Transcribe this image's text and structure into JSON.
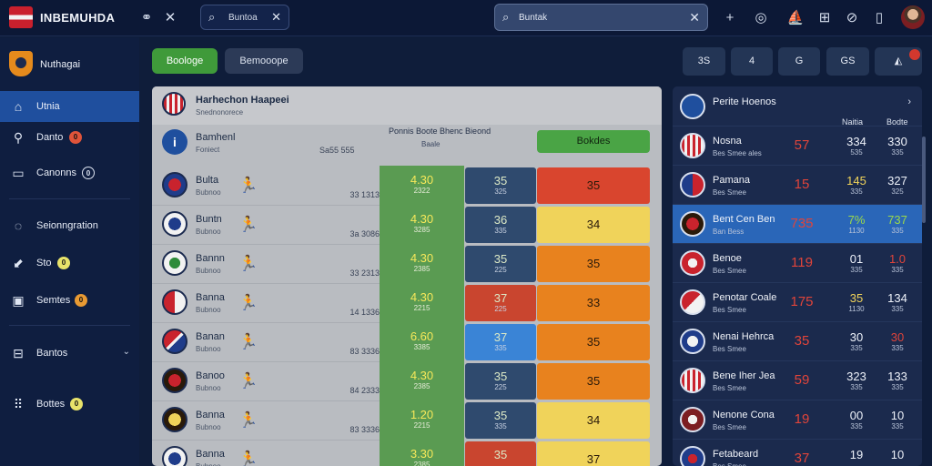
{
  "app": {
    "brand": "INBEMUHDA"
  },
  "top_search": {
    "value": "Buntoa",
    "placeholder": "Buntoa"
  },
  "main_search": {
    "value": "Buntak",
    "placeholder": "Buntak"
  },
  "sidebar": {
    "header": "Nuthagai",
    "items": [
      {
        "label": "Utnia",
        "icon": "home-icon",
        "active": true
      },
      {
        "label": "Danto",
        "icon": "person-icon",
        "dot": "0",
        "dot_color": "#e0543a"
      },
      {
        "label": "Canonns",
        "icon": "briefcase-icon",
        "dot": "0",
        "dot_color": "#dfe6f3"
      },
      {
        "label": "Seionngration",
        "icon": "settings-icon"
      },
      {
        "label": "Sto",
        "icon": "tag-icon",
        "dot": "0",
        "dot_color": "#e8e36a"
      },
      {
        "label": "Semtes",
        "icon": "bag-icon",
        "dot": "0",
        "dot_color": "#e89a33"
      },
      {
        "label": "Bantos",
        "icon": "chart-icon"
      },
      {
        "label": "Bottes",
        "icon": "grid-icon",
        "dot": "0",
        "dot_color": "#e8e36a"
      }
    ]
  },
  "actions": {
    "green_label": "Boologe",
    "dark_label": "Bemooope",
    "icon_buttons": [
      "3S",
      "4",
      "G",
      "GS"
    ]
  },
  "center": {
    "title": "Harhechon Haapeei",
    "subtitle": "Snednonorece",
    "col_header": "Ponnis Boote Bhenc Bieond",
    "col_sub": "Baale",
    "green_header": "Bokdes",
    "info": {
      "name": "Bamhenl",
      "sub": "Foniect",
      "value": "Sa55 555"
    },
    "rows": [
      {
        "name": "Bulta",
        "sub": "Bubnoo",
        "value": "33 1313",
        "odd1": "4.30",
        "odd1_sub": "2322",
        "odd2": "35",
        "odd2_sub": "325",
        "odd3": "35"
      },
      {
        "name": "Buntn",
        "sub": "Bubnoo",
        "value": "3a 3086",
        "odd1": "4.30",
        "odd1_sub": "3285",
        "odd2": "36",
        "odd2_sub": "335",
        "odd3": "34"
      },
      {
        "name": "Bannn",
        "sub": "Bubnoo",
        "value": "33 2313",
        "odd1": "4.30",
        "odd1_sub": "2385",
        "odd2": "35",
        "odd2_sub": "225",
        "odd3": "35"
      },
      {
        "name": "Banna",
        "sub": "Bubnoo",
        "value": "14 1336",
        "odd1": "4.30",
        "odd1_sub": "2215",
        "odd2": "37",
        "odd2_sub": "225",
        "odd3": "33"
      },
      {
        "name": "Banan",
        "sub": "Bubnoo",
        "value": "83 3336",
        "odd1": "6.60",
        "odd1_sub": "3385",
        "odd2": "37",
        "odd2_sub": "335",
        "odd3": "35"
      },
      {
        "name": "Banoo",
        "sub": "Bubnoo",
        "value": "84 2333",
        "odd1": "4.30",
        "odd1_sub": "2385",
        "odd2": "35",
        "odd2_sub": "225",
        "odd3": "35"
      },
      {
        "name": "Banna",
        "sub": "Bubnoo",
        "value": "83 3336",
        "odd1": "1.20",
        "odd1_sub": "2215",
        "odd2": "35",
        "odd2_sub": "335",
        "odd3": "34"
      },
      {
        "name": "Banna",
        "sub": "Bubnoo",
        "value": "",
        "odd1": "3.30",
        "odd1_sub": "2385",
        "odd2": "35",
        "odd2_sub": "",
        "odd3": "37"
      }
    ]
  },
  "right": {
    "title": "Perite Hoenos",
    "col1": "Naitia",
    "col2": "Bodte",
    "rows": [
      {
        "name": "Nosna",
        "sub": "Bes Smee ales",
        "o1": "57",
        "o2": "334",
        "o2_sub": "535",
        "o3": "330",
        "o3_sub": "335"
      },
      {
        "name": "Pamana",
        "sub": "Bes Smee",
        "o1": "15",
        "o2": "145",
        "o2_sub": "335",
        "o3": "327",
        "o3_sub": "325"
      },
      {
        "name": "Bent Cen Ben",
        "sub": "Ban Bess",
        "o1": "735",
        "o2": "7%",
        "o2_sub": "1130",
        "o3": "737",
        "o3_sub": "335",
        "active": true
      },
      {
        "name": "Benoe",
        "sub": "Bes Smee",
        "o1": "119",
        "o2": "01",
        "o2_sub": "335",
        "o3": "1.0",
        "o3_sub": "335"
      },
      {
        "name": "Penotar Coale",
        "sub": "Bes Smee",
        "o1": "175",
        "o2": "35",
        "o2_sub": "1130",
        "o3": "134",
        "o3_sub": "335"
      },
      {
        "name": "Nenai Hehrca",
        "sub": "Bes Smee",
        "o1": "35",
        "o2": "30",
        "o2_sub": "335",
        "o3": "30",
        "o3_sub": "335"
      },
      {
        "name": "Bene Iher Jea",
        "sub": "Bes Smee",
        "o1": "59",
        "o2": "323",
        "o2_sub": "335",
        "o3": "133",
        "o3_sub": "335"
      },
      {
        "name": "Nenone Cona",
        "sub": "Bes Smee",
        "o1": "19",
        "o2": "00",
        "o2_sub": "335",
        "o3": "10",
        "o3_sub": "335"
      },
      {
        "name": "Fetabeard",
        "sub": "Bes Smee",
        "o1": "37",
        "o2": "19",
        "o2_sub": "",
        "o3": "10",
        "o3_sub": ""
      }
    ]
  },
  "colors": {
    "accent_blue": "#1f4f9e",
    "green": "#3f9a3a",
    "orange": "#e8821e",
    "red": "#d9452e",
    "yellow": "#f0d35a"
  }
}
